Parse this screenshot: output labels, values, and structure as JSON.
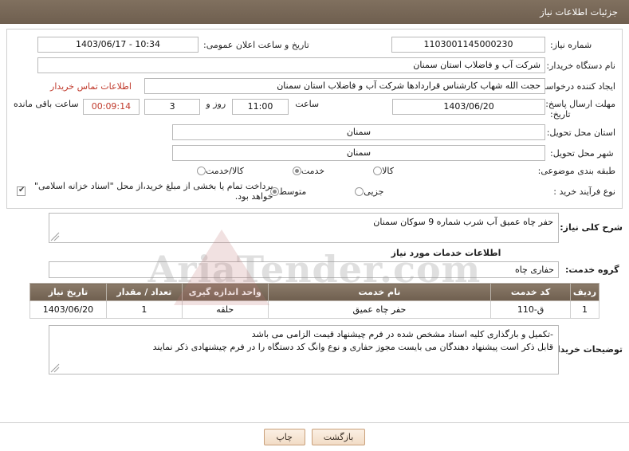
{
  "header": {
    "title": "جزئیات اطلاعات نیاز"
  },
  "form": {
    "need_number_label": "شماره نیاز:",
    "need_number_value": "1103001145000230",
    "announce_datetime_label": "تاریخ و ساعت اعلان عمومی:",
    "announce_datetime_value": "1403/06/17 - 10:34",
    "buyer_org_label": "نام دستگاه خریدار:",
    "buyer_org_value": "شرکت آب و فاضلاب استان سمنان",
    "requester_label": "ایجاد کننده درخواست:",
    "requester_value": "حجت الله شهاب کارشناس قراردادها شرکت آب و فاضلاب استان سمنان",
    "contact_link": "اطلاعات تماس خریدار",
    "deadline_label_line1": "مهلت ارسال پاسخ: تا",
    "deadline_label_line2": "تاریخ:",
    "deadline_date": "1403/06/20",
    "time_label": "ساعت",
    "deadline_time": "11:00",
    "days_label": "روز و",
    "days_value": "3",
    "remaining_time": "00:09:14",
    "remaining_label": "ساعت باقی مانده",
    "province_label": "استان محل تحویل:",
    "province_value": "سمنان",
    "city_label": "شهر محل تحویل:",
    "city_value": "سمنان",
    "category_label": "طبقه بندی موضوعی:",
    "category_options": [
      {
        "label": "کالا",
        "selected": false
      },
      {
        "label": "خدمت",
        "selected": true
      },
      {
        "label": "کالا/خدمت",
        "selected": false
      }
    ],
    "process_label": "نوع فرآیند خرید :",
    "process_options": [
      {
        "label": "جزیی",
        "selected": false
      },
      {
        "label": "متوسط",
        "selected": true
      }
    ],
    "payment_checkbox_label": "پرداخت تمام یا بخشی از مبلغ خرید،از محل \"اسناد خزانه اسلامی\" خواهد بود.",
    "payment_checked": true
  },
  "summary": {
    "label": "شرح کلی نیاز:",
    "value": "حفر چاه عمیق آب شرب شماره 9 سوکان سمنان"
  },
  "services": {
    "heading": "اطلاعات خدمات مورد نیاز",
    "group_label": "گروه خدمت:",
    "group_value": "حفاری چاه",
    "columns": [
      "ردیف",
      "کد خدمت",
      "نام خدمت",
      "واحد اندازه گیری",
      "تعداد / مقدار",
      "تاریخ نیاز"
    ],
    "rows": [
      {
        "index": "1",
        "code": "ق-110",
        "name": "حفر چاه عمیق",
        "unit": "حلقه",
        "qty": "1",
        "date": "1403/06/20"
      }
    ]
  },
  "buyer_notes": {
    "label": "توضیحات خریدار:",
    "line1": "-تکمیل و بارگذاری کلیه اسناد مشخص شده در فرم چیشنهاد قیمت الزامی می باشد",
    "line2": "قابل ذکر است پیشنهاد دهندگان می بایست مجوز حفاری و نوع وانگ کد دستگاه را در فرم چیشنهادی ذکر نمایند"
  },
  "footer": {
    "print_button": "چاپ",
    "back_button": "بازگشت"
  },
  "watermark": {
    "text": "AriaTender.com"
  }
}
